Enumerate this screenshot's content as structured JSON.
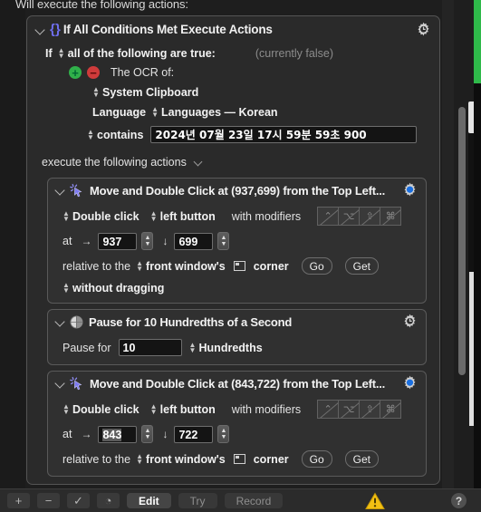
{
  "caption": "Will execute the following actions:",
  "group": {
    "title": "If All Conditions Met Execute Actions",
    "gear_icon": "gear-icon",
    "brace_icon": "braces-icon",
    "if_label": "If",
    "if_condition": "all of the following are true:",
    "if_status": "(currently false)",
    "add_icon": "plus-circle-icon",
    "remove_icon": "minus-circle-icon",
    "condition_label": "The OCR of:",
    "source": "System Clipboard",
    "language_label": "Language",
    "language_value": "Languages — Korean",
    "comparison": "contains",
    "match_text": "2024년 07월 23일 17시 59분 59초 900",
    "execute_label": "execute the following actions"
  },
  "actions": [
    {
      "title": "Move and Double Click at (937,699) from the Top Left...",
      "icon": "click-cursor-icon",
      "gear_icon": "gear-icon",
      "gear_active": "false",
      "click_type": "Double click",
      "button": "left button",
      "modifiers_label": "with modifiers",
      "modifiers": [
        "⌃",
        "⌥",
        "⇧",
        "⌘"
      ],
      "at_label": "at",
      "x_arrow": "→",
      "x_value": "937",
      "y_arrow": "↓",
      "y_value": "699",
      "relative_label": "relative to the",
      "relative_value": "front window's",
      "corner_label": "corner",
      "go_label": "Go",
      "get_label": "Get",
      "drag_value": "without dragging"
    },
    {
      "title": "Pause for 10 Hundredths of a Second",
      "icon": "pause-clock-icon",
      "gear_icon": "gear-icon",
      "pause_label": "Pause for",
      "pause_value": "10",
      "pause_unit": "Hundredths"
    },
    {
      "title": "Move and Double Click at (843,722) from the Top Left...",
      "icon": "click-cursor-icon",
      "gear_icon": "gear-icon",
      "gear_active": "true",
      "click_type": "Double click",
      "button": "left button",
      "modifiers_label": "with modifiers",
      "modifiers": [
        "⌃",
        "⌥",
        "⇧",
        "⌘"
      ],
      "at_label": "at",
      "x_arrow": "→",
      "x_value": "843",
      "y_arrow": "↓",
      "y_value": "722",
      "relative_label": "relative to the",
      "relative_value": "front window's",
      "corner_label": "corner",
      "go_label": "Go",
      "get_label": "Get"
    }
  ],
  "toolbar": {
    "add": "+",
    "remove": "−",
    "enable": "✓",
    "schedule": "◔",
    "edit": "Edit",
    "try": "Try",
    "record": "Record",
    "warning_icon": "warning-triangle-icon",
    "help": "?"
  },
  "colors": {
    "accent_blue": "#1a6fe0",
    "brace_purple": "#6f6ff0",
    "add_green": "#30b04a",
    "remove_red": "#cf3b3b",
    "warning_yellow": "#f2c013"
  }
}
